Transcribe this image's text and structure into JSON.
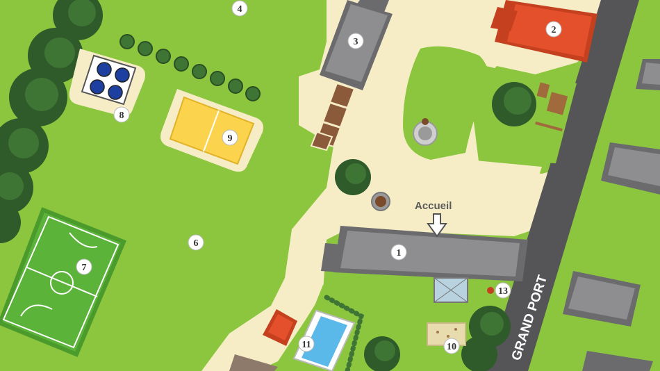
{
  "labels": {
    "welcome": "Accueil",
    "road": "GRAND PORT"
  },
  "markers": {
    "m1": "1",
    "m2": "2",
    "m3": "3",
    "m4": "4",
    "m6": "6",
    "m7": "7",
    "m8": "8",
    "m9": "9",
    "m10": "10",
    "m11": "11",
    "m13": "13"
  },
  "colors": {
    "grass": "#8cc63f",
    "path": "#f7efc9",
    "road": "#555557",
    "roof_gray": "#7a7a7c",
    "roof_red": "#e4502c",
    "field_green": "#5bb33a",
    "court_yellow": "#fbd34d",
    "pool_blue": "#5ab9e8",
    "tree_green": "#3e6e34",
    "petanque_blue": "#1c3fa0"
  }
}
